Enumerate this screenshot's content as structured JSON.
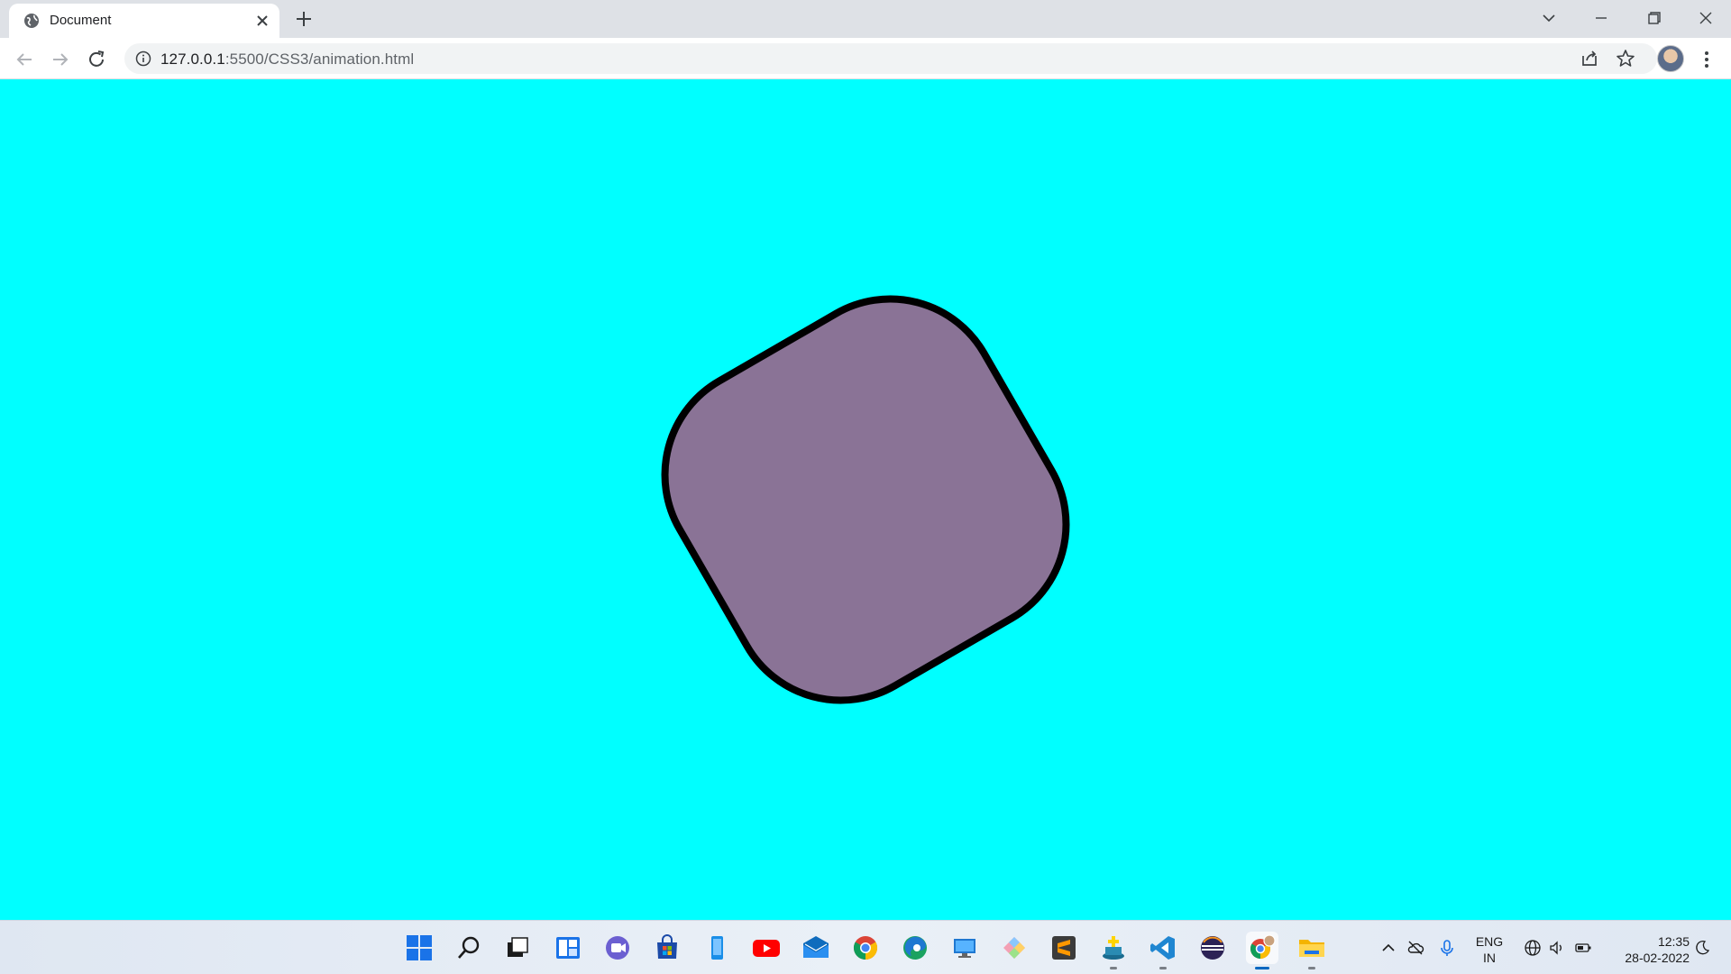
{
  "browser": {
    "tab": {
      "title": "Document"
    },
    "address_bar": {
      "host": "127.0.0.1",
      "rest": ":5500/CSS3/animation.html"
    }
  },
  "page": {
    "background": "#00ffff",
    "shape_fill": "#8a7396",
    "shape_stroke": "#000000"
  },
  "taskbar": {
    "apps": [
      "start-icon",
      "search-icon",
      "task-view-icon",
      "widgets-icon",
      "teams-chat-icon",
      "microsoft-store-icon",
      "phone-icon",
      "youtube-icon",
      "mail-icon",
      "chrome-icon",
      "edge-icon",
      "remote-desktop-icon",
      "git-icon",
      "sublime-text-icon",
      "app-installer-icon",
      "vscode-icon",
      "eclipse-icon",
      "chrome-profile-icon",
      "file-explorer-icon"
    ],
    "language": {
      "line1": "ENG",
      "line2": "IN"
    },
    "clock": {
      "time": "12:35",
      "date": "28-02-2022"
    }
  }
}
